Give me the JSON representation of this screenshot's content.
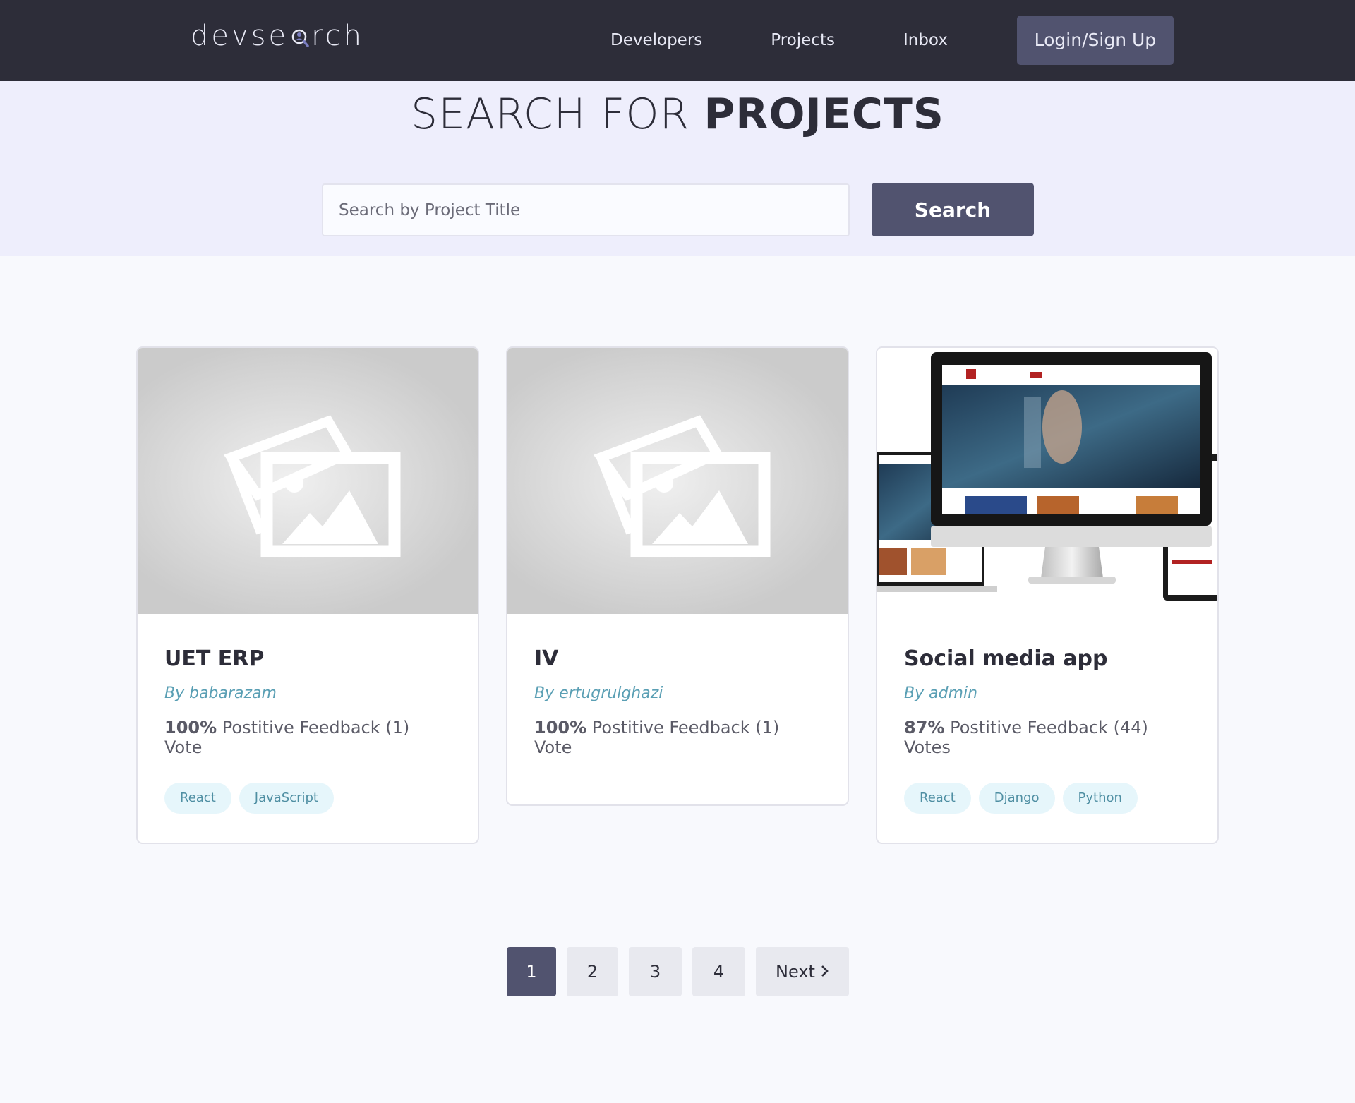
{
  "header": {
    "logo_text_left": "devse",
    "logo_text_right": "rch",
    "nav": [
      "Developers",
      "Projects",
      "Inbox"
    ],
    "login_label": "Login/Sign Up"
  },
  "hero": {
    "title_light": "SEARCH FOR",
    "title_bold": "PROJECTS",
    "search_placeholder": "Search by Project Title",
    "search_button": "Search"
  },
  "projects": [
    {
      "title": "UET ERP",
      "author": "By babarazam",
      "percent": "100%",
      "feedback": " Postitive Feedback (1) Vote",
      "tags": [
        "React",
        "JavaScript"
      ],
      "image": "placeholder-image"
    },
    {
      "title": "IV",
      "author": "By ertugrulghazi",
      "percent": "100%",
      "feedback": " Postitive Feedback (1) Vote",
      "tags": [],
      "image": "placeholder-image"
    },
    {
      "title": "Social media app",
      "author": "By admin",
      "percent": "87%",
      "feedback": " Postitive Feedback (44) Votes",
      "tags": [
        "React",
        "Django",
        "Python"
      ],
      "image": "devices-mockup"
    }
  ],
  "pagination": {
    "pages": [
      "1",
      "2",
      "3",
      "4"
    ],
    "active": "1",
    "next_label": "Next"
  },
  "colors": {
    "header_bg": "#2d2d39",
    "hero_bg": "#eeeefc",
    "accent": "#51536f",
    "tag_bg": "#e6f6fb",
    "author": "#5a9fb4"
  }
}
